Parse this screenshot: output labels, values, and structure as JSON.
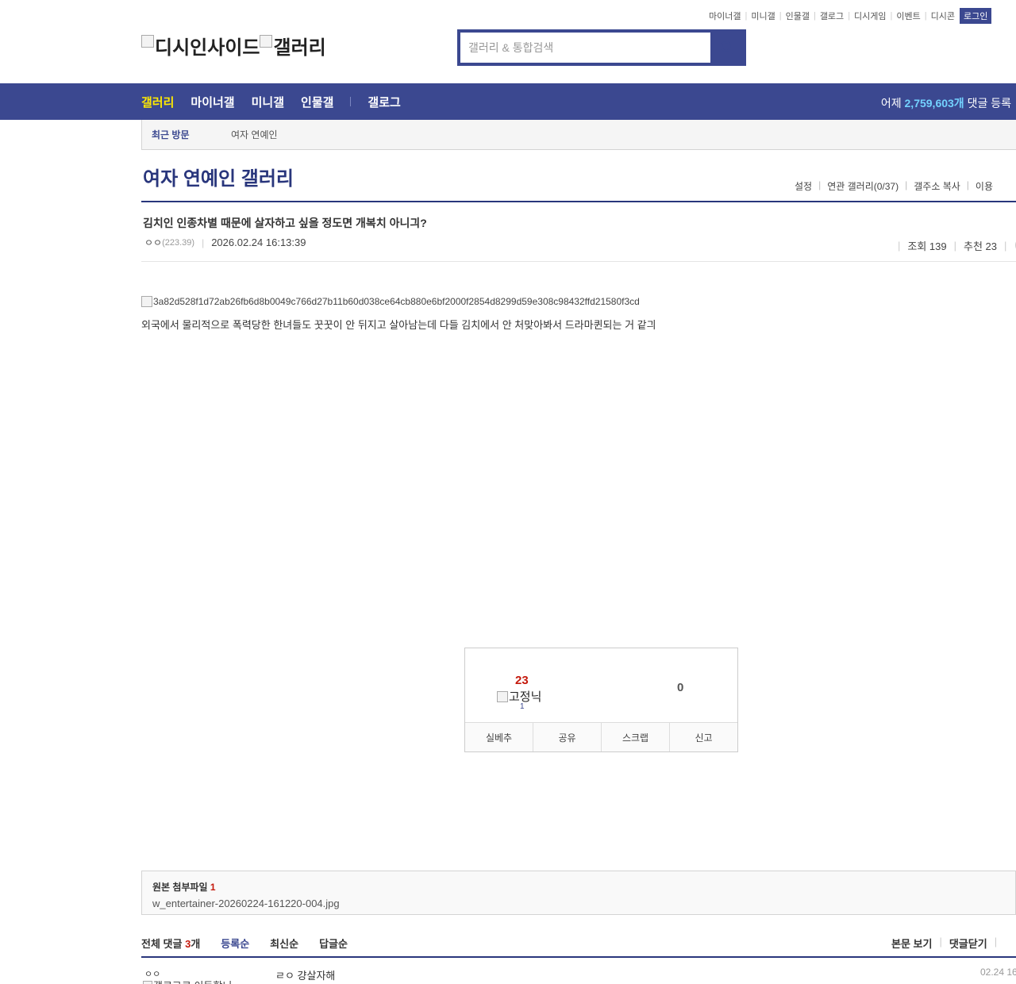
{
  "util_links": [
    "마이너갤",
    "미니갤",
    "인물갤",
    "갤로그",
    "디시게임",
    "이벤트",
    "디시콘"
  ],
  "login_label": "로그인",
  "logo": {
    "main_alt": "디시인사이드",
    "sub_alt": "갤러리"
  },
  "search": {
    "placeholder": "갤러리 & 통합검색"
  },
  "nav": {
    "items": [
      "갤러리",
      "마이너갤",
      "미니갤",
      "인물갤",
      "갤로그"
    ],
    "stat_prefix": "어제",
    "stat_value": "2,759,603개",
    "stat_suffix": "댓글 등록"
  },
  "recent": {
    "label": "최근 방문",
    "item": "여자 연예인"
  },
  "gallery": {
    "title": "여자 연예인 갤러리",
    "tools": [
      "설정",
      "연관 갤러리(0/37)",
      "갤주소 복사",
      "이용"
    ]
  },
  "post": {
    "title": "김치인 인종차별 때문에 살자하고 싶을 정도면 개복치 아니긔?",
    "author": "ㅇㅇ",
    "ip": "(223.39)",
    "date": "2026.02.24 16:13:39",
    "views_label": "조회 139",
    "recommend_label": "추천 23",
    "image_alt": "3a82d528f1d72ab26fb6d8b0049c766d27b11b60d038ce64cb880e6bf2000f2854d8299d59e308c98432ffd21580f3cd",
    "body": "외국에서 물리적으로 폭력당한 한녀들도 꿋꿋이 안 뒤지고 살아남는데 다들 김치에서 안 처맞아봐서 드라마퀸되는 거 같긔"
  },
  "vote": {
    "up_count": "23",
    "fixnik_alt": "고정닉",
    "fixnik_count": "1",
    "down_count": "0",
    "buttons": [
      "실베추",
      "공유",
      "스크랩",
      "신고"
    ]
  },
  "attachment": {
    "label": "원본 첨부파일",
    "count": "1",
    "file": "w_entertainer-20260224-161220-004.jpg"
  },
  "comments": {
    "total_label": "전체 댓글",
    "total_count": "3",
    "total_unit": "개",
    "sorts": [
      "등록순",
      "최신순",
      "답글순"
    ],
    "view_post": "본문 보기",
    "close_comments": "댓글닫기",
    "items": [
      {
        "nick": "ㅇㅇ",
        "gallog_alt": "갤로그로 이동합니",
        "text": "ㄹㅇ 걍살자해",
        "date": "02.24 16"
      }
    ]
  },
  "colors": {
    "brand": "#3b4890",
    "title": "#29367c",
    "highlight": "#ffea00",
    "accent_red": "#c4190c",
    "stat": "#73d2ff"
  }
}
